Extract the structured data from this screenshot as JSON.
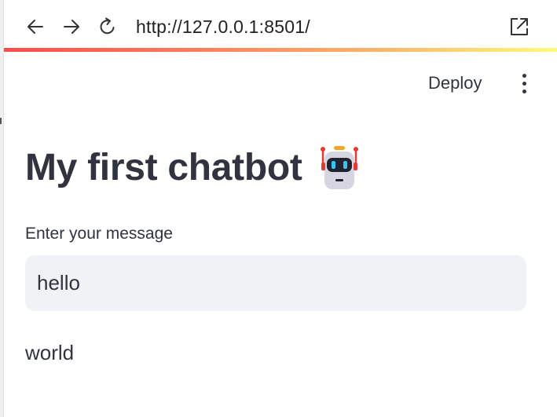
{
  "browser": {
    "url": "http://127.0.0.1:8501/",
    "back_icon": "arrow-left-icon",
    "forward_icon": "arrow-right-icon",
    "reload_icon": "reload-icon",
    "external_icon": "open-external-icon"
  },
  "header": {
    "deploy_label": "Deploy",
    "menu_icon": "more-vertical-icon"
  },
  "main": {
    "title": "My first chatbot",
    "title_emoji": "robot-icon",
    "input_label": "Enter your message",
    "input_value": "hello",
    "output_text": "world"
  },
  "colors": {
    "accent_gradient": [
      "#ff4b4b",
      "#fdb96a",
      "#fefb7c"
    ],
    "text": "#31333f",
    "input_bg": "#f0f2f6"
  }
}
